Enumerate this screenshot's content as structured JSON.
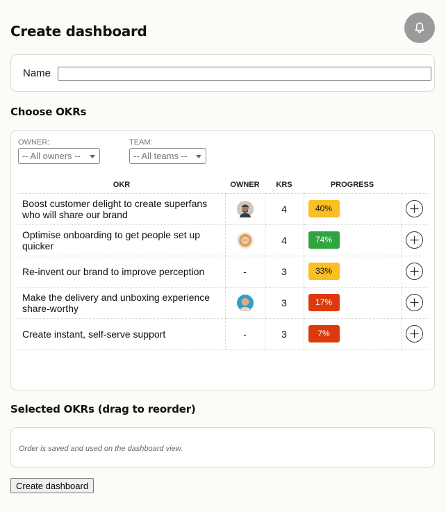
{
  "page": {
    "title": "Create dashboard"
  },
  "header": {
    "notification_icon": "bell-icon"
  },
  "name_form": {
    "label": "Name",
    "value": ""
  },
  "choose": {
    "heading": "Choose OKRs",
    "filters": {
      "owner_label": "OWNER:",
      "owner_selected": "-- All owners --",
      "team_label": "TEAM:",
      "team_selected": "-- All teams --"
    },
    "columns": {
      "okr": "OKR",
      "owner": "OWNER",
      "krs": "KRS",
      "progress": "PROGRESS"
    },
    "rows": [
      {
        "objective": "Boost customer delight to create superfans who will share our brand",
        "owner": "avatar",
        "krs": "4",
        "progress": "40%",
        "status_color": "#fbbf24",
        "text_color": "#111111"
      },
      {
        "objective": "Optimise onboarding to get people set up quicker",
        "owner": "avatar",
        "krs": "4",
        "progress": "74%",
        "status_color": "#2fa53f",
        "text_color": "#ffffff"
      },
      {
        "objective": "Re-invent our brand to improve perception",
        "owner": "-",
        "krs": "3",
        "progress": "33%",
        "status_color": "#fbbf24",
        "text_color": "#111111"
      },
      {
        "objective": "Make the delivery and unboxing experience share-worthy",
        "owner": "avatar",
        "krs": "3",
        "progress": "17%",
        "status_color": "#dc3a0c",
        "text_color": "#ffffff"
      },
      {
        "objective": "Create instant, self-serve support",
        "owner": "-",
        "krs": "3",
        "progress": "7%",
        "status_color": "#dc3a0c",
        "text_color": "#ffffff"
      }
    ],
    "add_icon": "plus-circle-icon"
  },
  "selected": {
    "heading": "Selected OKRs (drag to reorder)",
    "note": "Order is saved and used on the dashboard view."
  },
  "actions": {
    "create_label": "Create dashboard"
  }
}
